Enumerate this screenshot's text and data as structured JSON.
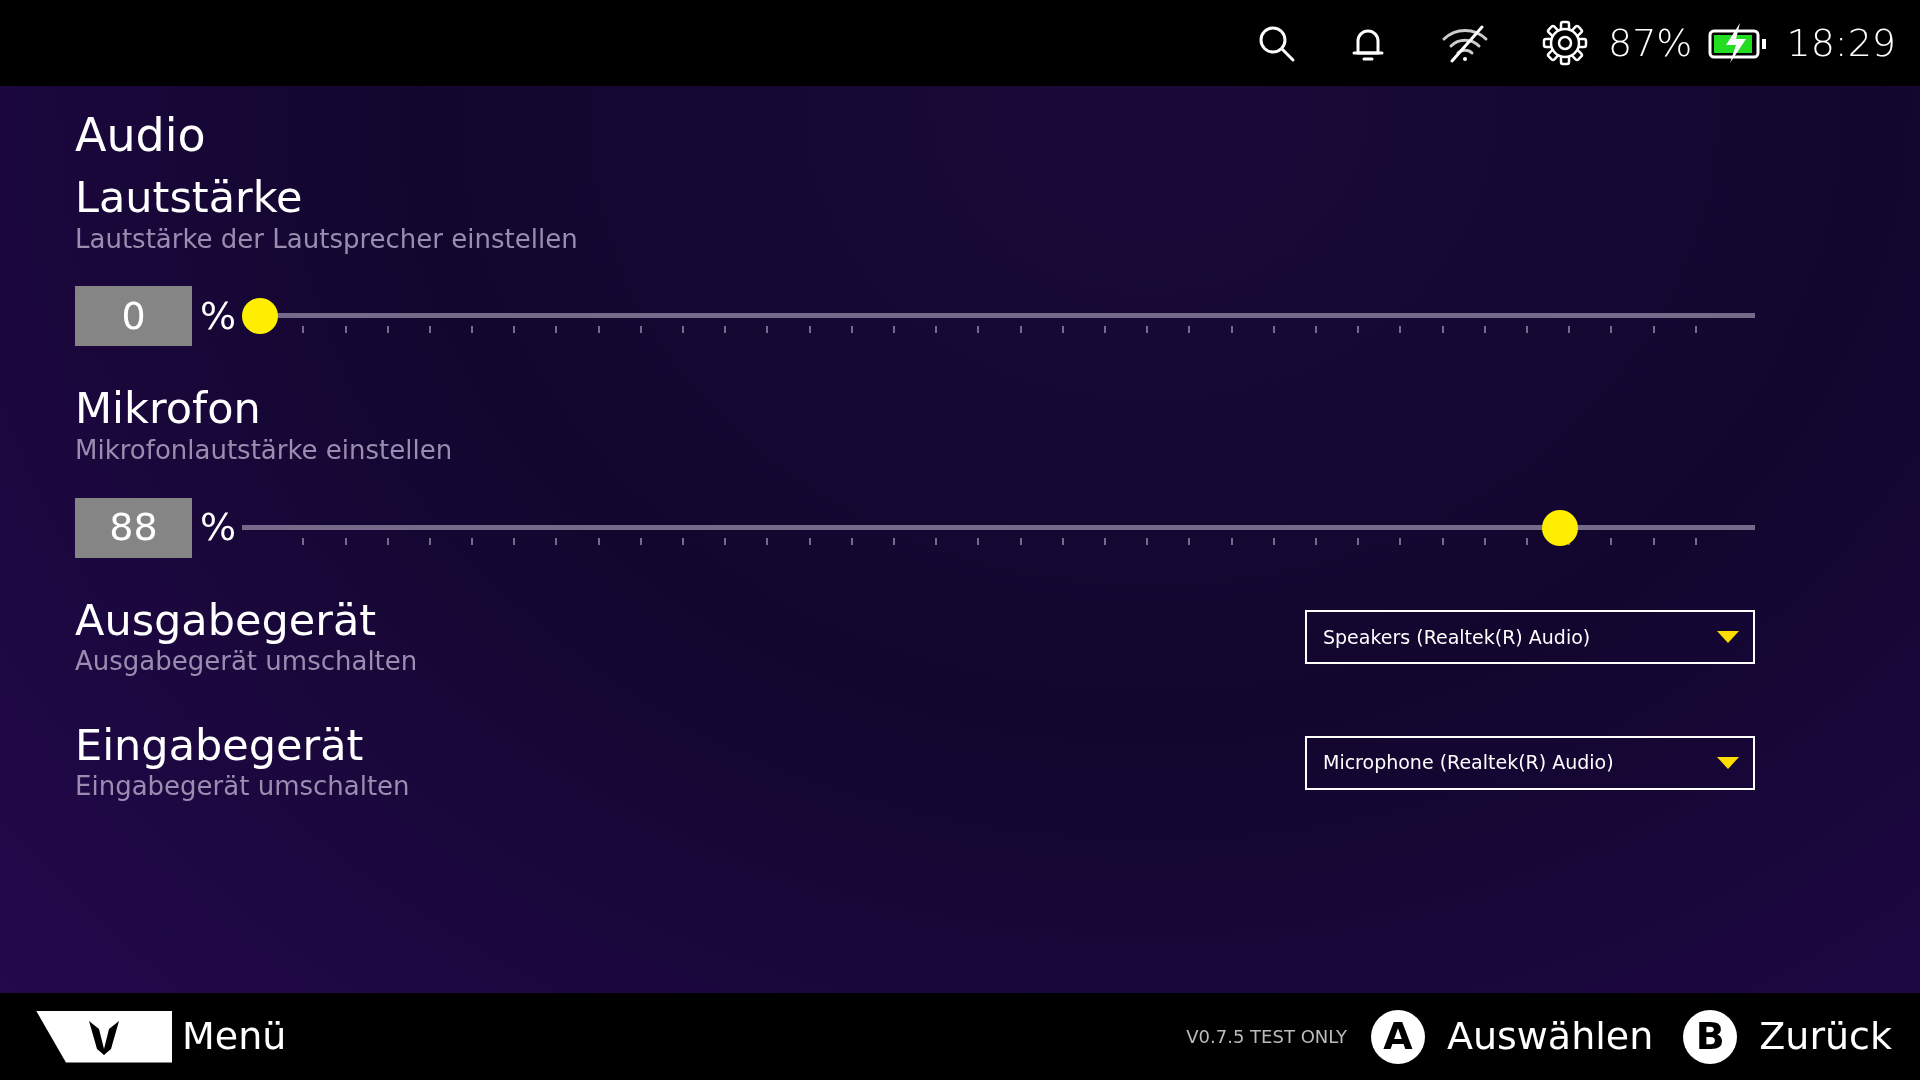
{
  "status_bar": {
    "battery_text": "87%",
    "time": "18:29"
  },
  "page_title": "Audio",
  "settings": [
    {
      "kind": "slider",
      "title": "Lautstärke",
      "subtitle": "Lautstärke der Lautsprecher einstellen",
      "value": "0",
      "unit": "%",
      "level": 0
    },
    {
      "kind": "slider",
      "title": "Mikrofon",
      "subtitle": "Mikrofonlautstärke einstellen",
      "value": "88",
      "unit": "%",
      "level": 0.88
    },
    {
      "kind": "dropdown",
      "title": "Ausgabegerät",
      "subtitle": "Ausgabegerät umschalten",
      "value": "Speakers (Realtek(R) Audio)"
    },
    {
      "kind": "dropdown",
      "title": "Eingabegerät",
      "subtitle": "Eingabegerät umschalten",
      "value": "Microphone (Realtek(R) Audio)"
    }
  ],
  "footer": {
    "menu_label": "Menü",
    "version": "V0.7.5 TEST ONLY",
    "actions": [
      {
        "key": "A",
        "label": "Auswählen"
      },
      {
        "key": "B",
        "label": "Zurück"
      }
    ]
  }
}
